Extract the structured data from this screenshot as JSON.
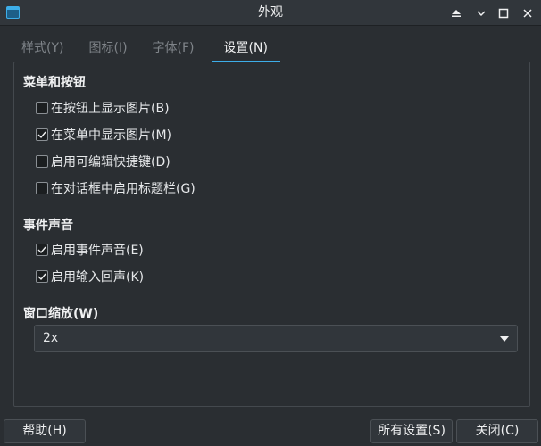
{
  "window": {
    "title": "外观"
  },
  "tabs": [
    {
      "label": "样式(Y)"
    },
    {
      "label": "图标(I)"
    },
    {
      "label": "字体(F)"
    },
    {
      "label": "设置(N)"
    }
  ],
  "menu_buttons": {
    "title": "菜单和按钮",
    "items": [
      {
        "label": "在按钮上显示图片(B)",
        "checked": false
      },
      {
        "label": "在菜单中显示图片(M)",
        "checked": true
      },
      {
        "label": "启用可编辑快捷键(D)",
        "checked": false
      },
      {
        "label": "在对话框中启用标题栏(G)",
        "checked": false
      }
    ]
  },
  "sounds": {
    "title": "事件声音",
    "items": [
      {
        "label": "启用事件声音(E)",
        "checked": true
      },
      {
        "label": "启用输入回声(K)",
        "checked": true
      }
    ]
  },
  "scaling": {
    "title": "窗口缩放(W)",
    "value": "2x"
  },
  "footer": {
    "help": "帮助(H)",
    "all_settings": "所有设置(S)",
    "close": "关闭(C)"
  },
  "colors": {
    "accent": "#3daee9",
    "background": "#2a2e32"
  }
}
